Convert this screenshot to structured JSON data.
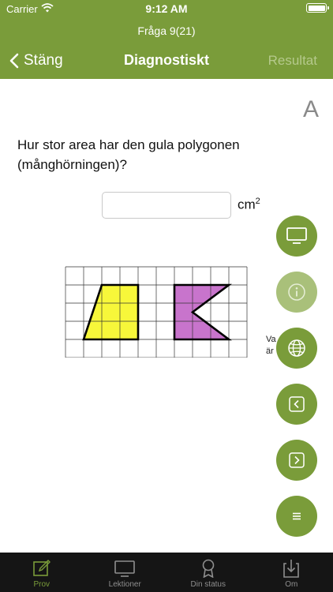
{
  "status_bar": {
    "carrier": "Carrier",
    "time": "9:12 AM"
  },
  "header": {
    "question_counter": "Fråga 9(21)",
    "back_label": "Stäng",
    "title": "Diagnostiskt",
    "results_label": "Resultat",
    "background_color": "#7a9c3a"
  },
  "content": {
    "font_size_toggle": "A",
    "question": "Hur stor area har den gula polygonen (månghörningen)?",
    "answer_value": "",
    "answer_placeholder": "",
    "unit": "cm",
    "unit_exponent": "2",
    "side_text_line1": "Va",
    "side_text_line2": "är",
    "figure": {
      "grid_columns": 10,
      "grid_rows": 5,
      "shapes": [
        {
          "name": "yellow-polygon",
          "color": "#f7f73a",
          "cells": [
            [
              2,
              1
            ],
            [
              4,
              1
            ],
            [
              4,
              4
            ],
            [
              1,
              4
            ]
          ]
        },
        {
          "name": "purple-polygon",
          "color": "#c874cc",
          "cells": [
            [
              6,
              1
            ],
            [
              9,
              1
            ],
            [
              7,
              2.5
            ],
            [
              9,
              4
            ],
            [
              6,
              4
            ]
          ]
        }
      ]
    }
  },
  "action_buttons": [
    {
      "name": "screen",
      "icon": "monitor-icon",
      "enabled": true
    },
    {
      "name": "info",
      "icon": "info-icon",
      "enabled": false
    },
    {
      "name": "language",
      "icon": "globe-icon",
      "enabled": true
    },
    {
      "name": "previous",
      "icon": "chevron-left-icon",
      "enabled": true
    },
    {
      "name": "next",
      "icon": "chevron-right-icon",
      "enabled": true
    },
    {
      "name": "menu",
      "icon": "menu-icon",
      "enabled": true
    }
  ],
  "tabs": [
    {
      "label": "Prov",
      "icon": "edit-icon",
      "active": true
    },
    {
      "label": "Lektioner",
      "icon": "monitor-icon",
      "active": false
    },
    {
      "label": "Din status",
      "icon": "award-icon",
      "active": false
    },
    {
      "label": "Om",
      "icon": "download-icon",
      "active": false
    }
  ],
  "colors": {
    "accent": "#7a9c3a",
    "accent_disabled": "#a9c07a",
    "tabbar": "#151515",
    "yellow": "#f7f73a",
    "purple": "#c874cc"
  }
}
